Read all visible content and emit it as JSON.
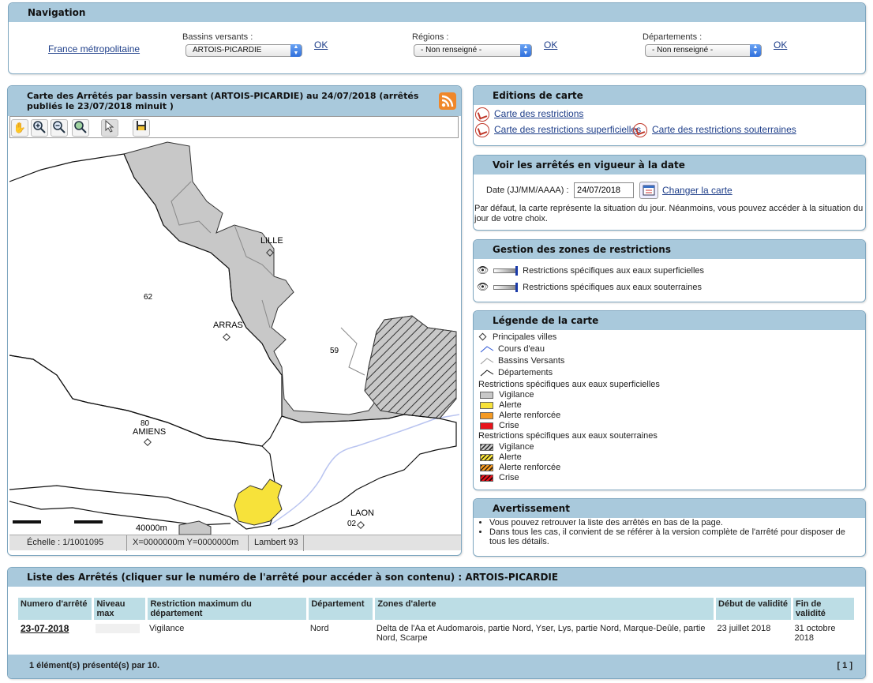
{
  "nav": {
    "title": "Navigation",
    "france_link": "France métropolitaine",
    "bassins_label": "Bassins versants :",
    "bassins_value": "ARTOIS-PICARDIE",
    "regions_label": "Régions :",
    "regions_value": "- Non renseigné -",
    "departements_label": "Départements :",
    "departements_value": "- Non renseigné -",
    "ok": "OK"
  },
  "map": {
    "title": "Carte des Arrêtés par bassin versant (ARTOIS-PICARDIE) au 24/07/2018 (arrêtés publiés le 23/07/2018 minuit )",
    "labels": {
      "lille": "LILLE",
      "arras": "ARRAS",
      "amiens": "AMIENS",
      "laon": "LAON",
      "d62": "62",
      "d59": "59",
      "d80": "80",
      "d02": "02",
      "scale": "40000m"
    },
    "status": {
      "echelle": "Échelle : 1/1001095",
      "coords": "X=0000000m Y=0000000m",
      "proj": "Lambert 93"
    },
    "colors": {
      "vigilance": "#c8c8c8",
      "alerte": "#f7e23a",
      "river": "#b9c4f0"
    }
  },
  "editions": {
    "title": "Editions de carte",
    "link1": "Carte des restrictions",
    "link2": "Carte des restrictions superficielles",
    "link3": "Carte des restrictions souterraines"
  },
  "date_panel": {
    "title": "Voir les arrêtés en vigueur à la date",
    "label": "Date (JJ/MM/AAAA) :",
    "value": "24/07/2018",
    "change": "Changer la carte",
    "info": "Par défaut, la carte représente la situation du jour. Néanmoins, vous pouvez accéder à la situation du jour de votre choix."
  },
  "zones": {
    "title": "Gestion des zones de restrictions",
    "sup": "Restrictions spécifiques aux eaux superficielles",
    "sout": "Restrictions spécifiques aux eaux souterraines"
  },
  "legend": {
    "title": "Légende de la carte",
    "villes": "Principales villes",
    "cours": "Cours d'eau",
    "bassins": "Bassins Versants",
    "depts": "Départements",
    "sup_title": "Restrictions spécifiques aux eaux superficielles",
    "sout_title": "Restrictions spécifiques aux eaux souterraines",
    "vigilance": "Vigilance",
    "alerte": "Alerte",
    "alerte_renf": "Alerte renforcée",
    "crise": "Crise",
    "colors": {
      "vigilance": "#c8c8c8",
      "alerte": "#f7e23a",
      "alerte_renf": "#f59a23",
      "crise": "#e8141c"
    }
  },
  "warning": {
    "title": "Avertissement",
    "item1": "Vous pouvez retrouver la liste des arrêtés en bas de la page.",
    "item2": "Dans tous les cas, il convient de se référer à la version complète de l'arrêté pour disposer de tous les détails."
  },
  "list": {
    "title": "Liste des Arrêtés (cliquer sur le numéro de l'arrêté pour accéder à son contenu) : ARTOIS-PICARDIE",
    "headers": {
      "num": "Numero d'arrêté",
      "niveau": "Niveau max",
      "restr": "Restriction maximum du département",
      "dept": "Département",
      "zones": "Zones d'alerte",
      "debut": "Début de validité",
      "fin": "Fin de validité"
    },
    "row": {
      "num": "23-07-2018",
      "restr": "Vigilance",
      "dept": "Nord",
      "zones": "Delta de l'Aa et Audomarois, partie Nord, Yser, Lys, partie Nord, Marque-Deûle, partie Nord, Scarpe",
      "debut": "23 juillet 2018",
      "fin": "31 octobre 2018"
    },
    "footer": "1 élément(s) présenté(s) par 10.",
    "pages": "[ 1 ]"
  }
}
